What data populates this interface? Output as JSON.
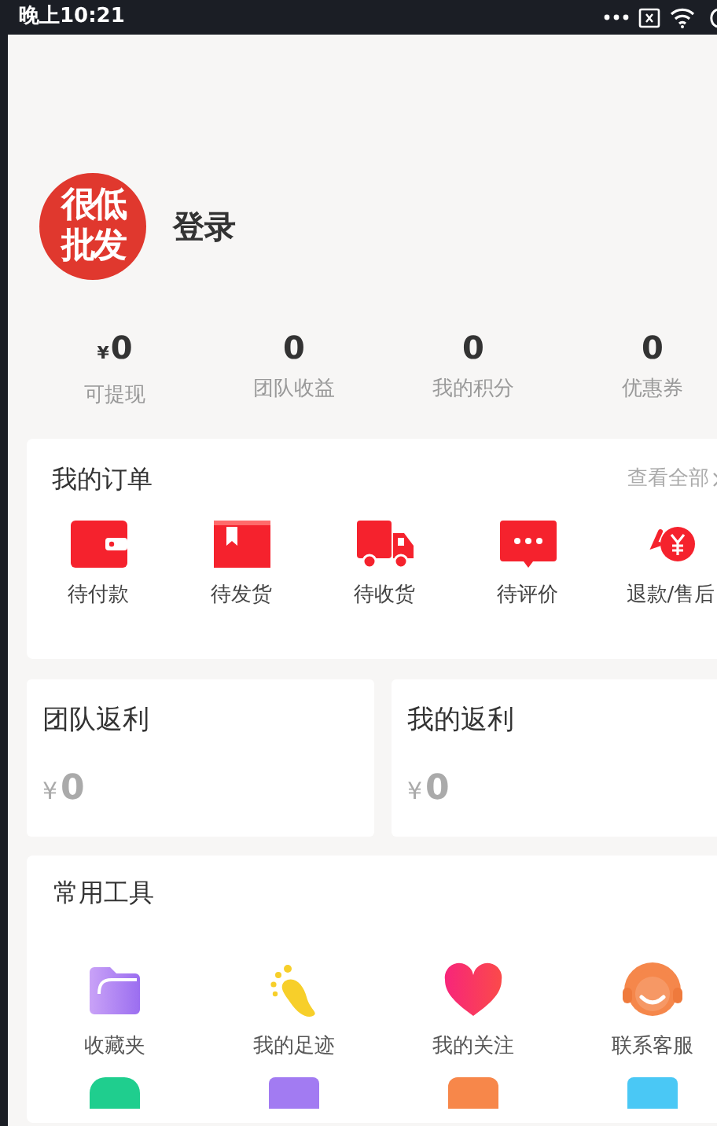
{
  "status_bar": {
    "time": "晚上10:21"
  },
  "profile": {
    "login_label": "登录",
    "logo_lines": [
      "很低",
      "批发"
    ]
  },
  "stats": [
    {
      "currency": "¥",
      "value": "0",
      "label": "可提现"
    },
    {
      "value": "0",
      "label": "团队收益"
    },
    {
      "value": "0",
      "label": "我的积分"
    },
    {
      "value": "0",
      "label": "优惠券"
    }
  ],
  "orders": {
    "title": "我的订单",
    "view_all": "查看全部",
    "items": [
      {
        "kind": "wallet",
        "label": "待付款"
      },
      {
        "kind": "box",
        "label": "待发货"
      },
      {
        "kind": "truck",
        "label": "待收货"
      },
      {
        "kind": "comment",
        "label": "待评价"
      },
      {
        "kind": "refund",
        "label": "退款/售后"
      }
    ]
  },
  "rebates": [
    {
      "title": "团队返利",
      "currency": "¥",
      "amount": "0"
    },
    {
      "title": "我的返利",
      "currency": "¥",
      "amount": "0"
    }
  ],
  "tools": {
    "title": "常用工具",
    "items": [
      {
        "kind": "folder",
        "label": "收藏夹"
      },
      {
        "kind": "footprint",
        "label": "我的足迹"
      },
      {
        "kind": "heart",
        "label": "我的关注"
      },
      {
        "kind": "headset",
        "label": "联系客服"
      }
    ]
  }
}
